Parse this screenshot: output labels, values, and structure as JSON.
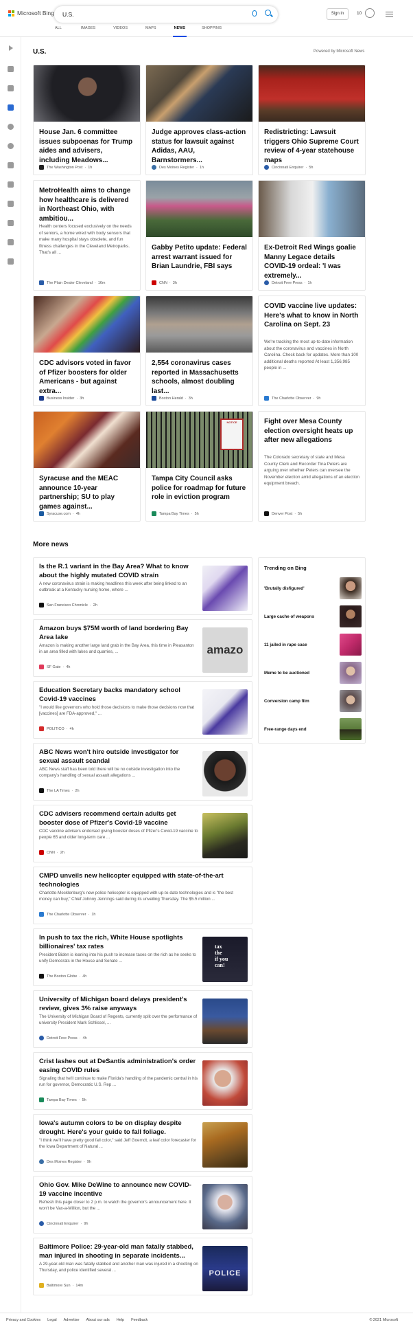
{
  "header": {
    "logo_text": "Microsoft Bing",
    "search_value": "U.S.",
    "signin_label": "Sign in",
    "rewards_count": "10",
    "tabs": [
      {
        "label": "ALL"
      },
      {
        "label": "IMAGES"
      },
      {
        "label": "VIDEOS"
      },
      {
        "label": "MAPS"
      },
      {
        "label": "NEWS",
        "active": true
      },
      {
        "label": "SHOPPING"
      }
    ]
  },
  "section": {
    "title": "U.S.",
    "powered_by": "Powered by Microsoft News"
  },
  "cards": [
    {
      "title": "House Jan. 6 committee issues subpoenas for Trump aides and advisers, including Meadows...",
      "summary": "",
      "source": "The Washington Post",
      "time": "1h"
    },
    {
      "title": "Judge approves class-action status for lawsuit against Adidas, AAU, Barnstormers...",
      "summary": "",
      "source": "Des Moines Register",
      "time": "1h"
    },
    {
      "title": "Redistricting: Lawsuit triggers Ohio Supreme Court review of 4-year statehouse maps",
      "summary": "",
      "source": "Cincinnati Enquirer",
      "time": "5h"
    },
    {
      "title": "MetroHealth aims to change how healthcare is delivered in Northeast Ohio, with ambitiou...",
      "summary": "Health centers focused exclusively on the needs of seniors, a home wired with body sensors that make many hospital stays obsolete, and fun fitness challenges in the Cleveland Metroparks. That's all ...",
      "source": "The Plain Dealer Cleveland",
      "time": "16m"
    },
    {
      "title": "Gabby Petito update: Federal arrest warrant issued for Brian Laundrie, FBI says",
      "summary": "",
      "source": "CNN",
      "time": "3h"
    },
    {
      "title": "Ex-Detroit Red Wings goalie Manny Legace details COVID-19 ordeal: 'I was extremely...",
      "summary": "",
      "source": "Detroit Free Press",
      "time": "1h"
    },
    {
      "title": "CDC advisors voted in favor of Pfizer boosters for older Americans - but against extra...",
      "summary": "",
      "source": "Business Insider",
      "time": "3h"
    },
    {
      "title": "2,554 coronavirus cases reported in Massachusetts schools, almost doubling last...",
      "summary": "",
      "source": "Boston Herald",
      "time": "3h"
    },
    {
      "title": "COVID vaccine live updates: Here's what to know in North Carolina on Sept. 23",
      "summary": "We're tracking the most up-to-date information about the coronavirus and vaccines in North Carolina. Check back for updates. More than 100 additional deaths reported At least 1,356,985 people in ...",
      "source": "The Charlotte Observer",
      "time": "9h"
    },
    {
      "title": "Syracuse and the MEAC announce 10-year partnership; SU to play games against...",
      "summary": "",
      "source": "Syracuse.com",
      "time": "4h"
    },
    {
      "title": "Tampa City Council asks police for roadmap for future role in eviction program",
      "summary": "",
      "source": "Tampa Bay Times",
      "time": "5h"
    },
    {
      "title": "Fight over Mesa County election oversight heats up after new allegations",
      "summary": "The Colorado secretary of state and Mesa County Clerk and Recorder Tina Peters are arguing over whether Peters can oversee the November election amid allegations of an election equipment breach.",
      "source": "Denver Post",
      "time": "5h"
    }
  ],
  "more_news": {
    "title": "More news",
    "items": [
      {
        "title": "Is the R.1 variant in the Bay Area? What to know about the highly mutated COVID strain",
        "summary": "A new coronavirus strain is making headlines this week after being linked to an outbreak at a Kentucky nursing home, where ...",
        "source": "San Francisco Chronicle",
        "time": "2h"
      },
      {
        "title": "Amazon buys $75M worth of land bordering Bay Area lake",
        "summary": "Amazon is making another large land grab in the Bay Area, this time in Pleasanton in an area filled with lakes and quarries, ...",
        "source": "SF Gate",
        "time": "4h"
      },
      {
        "title": "Education Secretary backs mandatory school Covid-19 vaccines",
        "summary": "\"I would like governors who hold those decisions to make those decisions now that [vaccines] are FDA-approved,\" ...",
        "source": "POLITICO",
        "time": "4h"
      },
      {
        "title": "ABC News won't hire outside investigator for sexual assault scandal",
        "summary": "ABC News staff has been told there will be no outside investigation into the company's handling of sexual assault allegations ...",
        "source": "The LA Times",
        "time": "2h"
      },
      {
        "title": "CDC advisers recommend certain adults get booster dose of Pfizer's Covid-19 vaccine",
        "summary": "CDC vaccine advisers endorsed giving booster doses of Pfizer's Covid-19 vaccine to people 65 and older long-term care ...",
        "source": "CNN",
        "time": "2h"
      },
      {
        "title": "CMPD unveils new helicopter equipped with state-of-the-art technologies",
        "summary": "Charlotte-Mecklenburg's new police helicopter is equipped with up-to-date technologies and is \"the best money can buy,\" Chief Johnny Jennings said during its unveiling Thursday. The $5.5 million ...",
        "source": "The Charlotte Observer",
        "time": "1h"
      },
      {
        "title": "In push to tax the rich, White House spotlights billionaires' tax rates",
        "summary": "President Biden is leaning into his push to increase taxes on the rich as he seeks to unify Democrats in the House and Senate ...",
        "source": "The Boston Globe",
        "time": "4h"
      },
      {
        "title": "University of Michigan board delays president's review, gives 3% raise anyways",
        "summary": "The University of Michigan Board of Regents, currently split over the performance of university President Mark Schlissel, ...",
        "source": "Detroit Free Press",
        "time": "4h"
      },
      {
        "title": "Crist lashes out at DeSantis administration's order easing COVID rules",
        "summary": "Signaling that he'll continue to make Florida's handling of the pandemic central in his run for governor, Democratic U.S. Rep ...",
        "source": "Tampa Bay Times",
        "time": "5h"
      },
      {
        "title": "Iowa's autumn colors to be on display despite drought. Here's your guide to fall foliage.",
        "summary": "\"I think we'll have pretty good fall color,\" said Jeff Goerndt, a leaf color forecaster for the Iowa Department of Natural ...",
        "source": "Des Moines Register",
        "time": "9h"
      },
      {
        "title": "Ohio Gov. Mike DeWine to announce new COVID-19 vaccine incentive",
        "summary": "Refresh this page closer to 2 p.m. to watch the governor's announcement here. It won't be Vax-a-Million, but the ...",
        "source": "Cincinnati Enquirer",
        "time": "9h"
      },
      {
        "title": "Baltimore Police: 29-year-old man fatally stabbed, man injured in shooting in separate incidents...",
        "summary": "A 29-year-old man was fatally stabbed and another man was injured in a shooting on Thursday, and police identified several ...",
        "source": "Baltimore Sun",
        "time": "14m"
      }
    ]
  },
  "trending": {
    "title": "Trending on Bing",
    "items": [
      {
        "label": "'Brutally disfigured'"
      },
      {
        "label": "Large cache of weapons"
      },
      {
        "label": "11 jailed in rape case"
      },
      {
        "label": "Meme to be auctioned"
      },
      {
        "label": "Conversion camp film"
      },
      {
        "label": "Free-range days end"
      }
    ]
  },
  "thumb_text": {
    "amazon": "amazo",
    "tax": "tax\nthe\nif you\ncan!",
    "police": "POLICE",
    "sign": "NOTICE"
  },
  "footer": {
    "links": [
      "Privacy and Cookies",
      "Legal",
      "Advertise",
      "About our ads",
      "Help",
      "Feedback"
    ],
    "copyright": "© 2021 Microsoft"
  }
}
